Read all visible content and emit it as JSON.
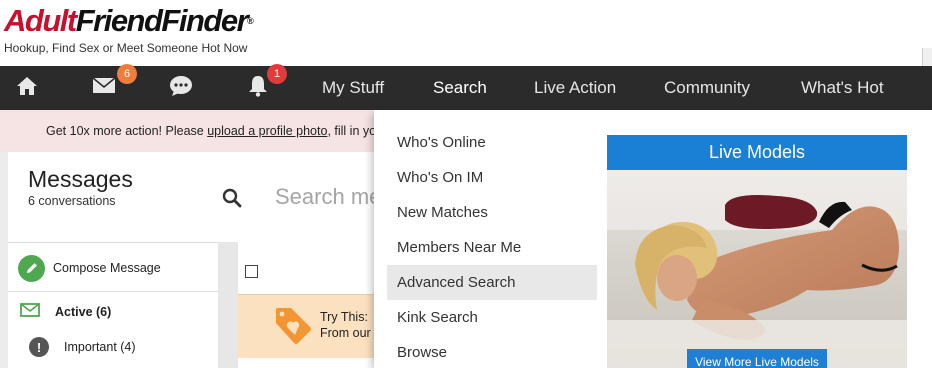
{
  "brand": {
    "logo_part1": "Adult",
    "logo_part2": "FriendFinder",
    "logo_mark": "®",
    "tagline": "Hookup, Find Sex or Meet Someone Hot Now",
    "red": "#c8102e"
  },
  "nav": {
    "icons": [
      {
        "name": "home-icon"
      },
      {
        "name": "mail-icon",
        "badge": "6",
        "badge_color": "#f07d3c"
      },
      {
        "name": "chat-icon"
      },
      {
        "name": "bell-icon",
        "badge": "1",
        "badge_color": "#e53a3a"
      }
    ],
    "links": [
      "My Stuff",
      "Search",
      "Live Action",
      "Community",
      "What's Hot"
    ],
    "active": "Search",
    "background": "#2b2b2b"
  },
  "notice": {
    "prefix": "Get 10x more action! Please ",
    "link": "upload a profile photo",
    "suffix": ", fill in yo"
  },
  "messages": {
    "title": "Messages",
    "subtitle": "6 conversations",
    "search_placeholder": "Search me"
  },
  "sidebar": {
    "compose": "Compose Message",
    "active": "Active (6)",
    "important": "Important (4)"
  },
  "list": {
    "try_line1": "Try This:",
    "try_line2": "From our"
  },
  "dropdown": {
    "items": [
      "Who's Online",
      "Who's On IM",
      "New Matches",
      "Members Near Me",
      "Advanced Search",
      "Kink Search",
      "Browse"
    ],
    "hovered": "Advanced Search",
    "live_title": "Live Models",
    "live_button": "View More Live Models",
    "live_accent": "#1a80d6"
  }
}
